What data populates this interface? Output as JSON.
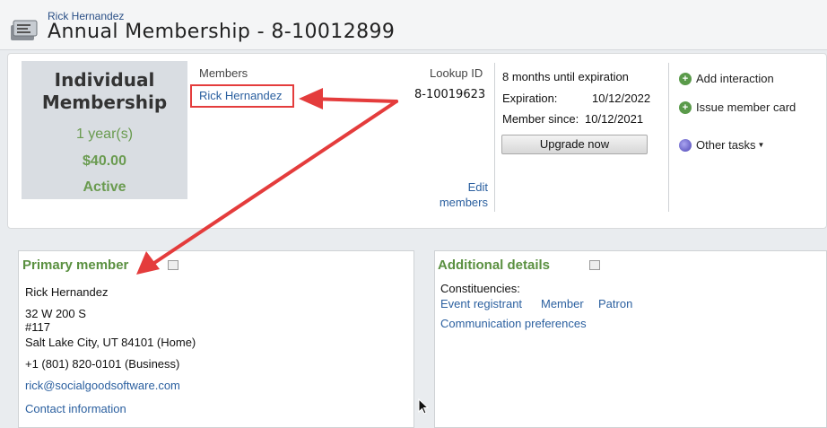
{
  "header": {
    "subtitle": "Rick Hernandez",
    "title": "Annual Membership - 8-10012899",
    "icon": "membership-record-icon"
  },
  "membership": {
    "type_line1": "Individual",
    "type_line2": "Membership",
    "term": "1 year(s)",
    "price": "$40.00",
    "status": "Active"
  },
  "members": {
    "heading": "Members",
    "name": "Rick Hernandez",
    "lookup_label": "Lookup ID",
    "lookup_value": "8-10019623",
    "edit_line1": "Edit",
    "edit_line2": "members"
  },
  "expiration": {
    "countdown": "8 months until expiration",
    "exp_label": "Expiration:",
    "exp_value": "10/12/2022",
    "since_label": "Member since:",
    "since_value": "10/12/2021",
    "upgrade_label": "Upgrade now"
  },
  "actions": {
    "add_interaction": "Add interaction",
    "issue_card": "Issue member card",
    "other_tasks": "Other tasks"
  },
  "primary": {
    "heading": "Primary member",
    "name": "Rick Hernandez",
    "address1": "32 W 200 S",
    "address2": "#117",
    "address3": "Salt Lake City, UT  84101 (Home)",
    "phone": "+1 (801) 820-0101 (Business)",
    "email": "rick@socialgoodsoftware.com",
    "contact_link": "Contact information"
  },
  "additional": {
    "heading": "Additional details",
    "constituencies_label": "Constituencies:",
    "constituencies": [
      "Event registrant",
      "Member",
      "Patron"
    ],
    "comm_link": "Communication preferences"
  },
  "colors": {
    "accent_green": "#5a9040",
    "link_blue": "#2a5f9f",
    "annotation_red": "#e43c3c"
  }
}
